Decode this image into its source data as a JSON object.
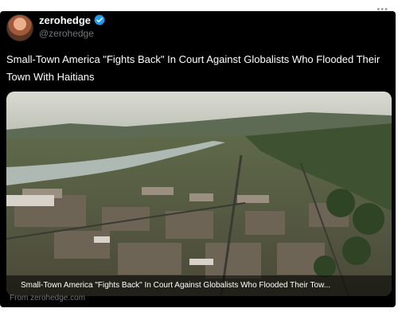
{
  "header": {
    "display_name": "zerohedge",
    "handle": "@zerohedge",
    "more_menu": "•••"
  },
  "tweet": {
    "text": "Small-Town America \"Fights Back\" In Court Against Globalists Who Flooded Their Town With Haitians"
  },
  "media": {
    "caption": "Small-Town America \"Fights Back\" In Court Against Globalists Who Flooded Their Tow...",
    "source": "From zerohedge.com"
  },
  "colors": {
    "card_background": "#000000",
    "text": "#ffffff",
    "muted": "#71767b",
    "verified": "#1d9bf0"
  }
}
